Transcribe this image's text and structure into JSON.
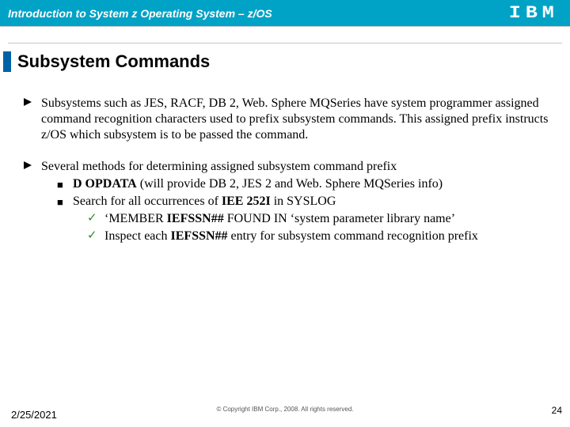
{
  "header": {
    "title": "Introduction to System z Operating System – z/OS",
    "logo_text": "IBM"
  },
  "slide": {
    "title": "Subsystem Commands"
  },
  "bullets": {
    "b1a": "Subsystems such as JES, RACF, DB 2, Web. Sphere MQSeries have system programmer assigned command recognition characters used to prefix subsystem commands.  This assigned prefix instructs z/OS which subsystem is to be passed the command.",
    "b1b": "Several methods for determining assigned subsystem command prefix",
    "b2a_pre": "D OPDATA",
    "b2a_post": "  (will provide DB 2, JES 2 and Web. Sphere MQSeries info)",
    "b2b_pre": "Search for all occurrences of ",
    "b2b_bold": "IEE 252I",
    "b2b_post": " in SYSLOG",
    "b3a_pre": "‘MEMBER ",
    "b3a_bold": "IEFSSN##",
    "b3a_post": " FOUND IN ‘system parameter library name’",
    "b3b_pre": "Inspect each ",
    "b3b_bold": "IEFSSN##",
    "b3b_post": " entry for subsystem command recognition prefix"
  },
  "footer": {
    "date": "2/25/2021",
    "copyright": "© Copyright IBM Corp., 2008. All rights reserved.",
    "page": "24"
  }
}
